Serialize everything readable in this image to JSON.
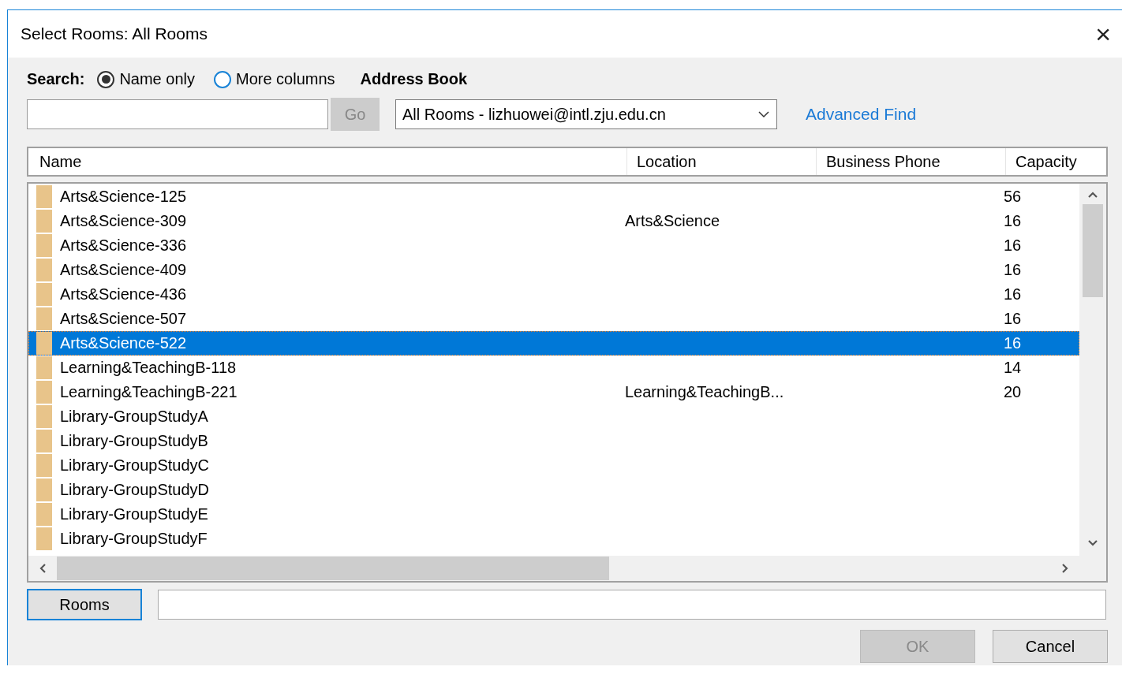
{
  "window": {
    "title": "Select Rooms: All Rooms",
    "close": "×"
  },
  "search": {
    "label": "Search:",
    "options": [
      {
        "label": "Name only",
        "selected": true
      },
      {
        "label": "More columns",
        "selected": false
      }
    ],
    "go_button": {
      "label": "Go",
      "disabled": true
    }
  },
  "address_book": {
    "label": "Address Book",
    "value": "All Rooms - lizhuowei@intl.zju.edu.cn"
  },
  "advanced_find": "Advanced Find",
  "table": {
    "columns": [
      "Name",
      "Location",
      "Business Phone",
      "Capacity"
    ],
    "rows": [
      {
        "name": "Arts&Science-125",
        "location": "",
        "phone": "",
        "capacity": "56",
        "selected": false
      },
      {
        "name": "Arts&Science-309",
        "location": "Arts&Science",
        "phone": "",
        "capacity": "16",
        "selected": false
      },
      {
        "name": "Arts&Science-336",
        "location": "",
        "phone": "",
        "capacity": "16",
        "selected": false
      },
      {
        "name": "Arts&Science-409",
        "location": "",
        "phone": "",
        "capacity": "16",
        "selected": false
      },
      {
        "name": "Arts&Science-436",
        "location": "",
        "phone": "",
        "capacity": "16",
        "selected": false
      },
      {
        "name": "Arts&Science-507",
        "location": "",
        "phone": "",
        "capacity": "16",
        "selected": false
      },
      {
        "name": "Arts&Science-522",
        "location": "",
        "phone": "",
        "capacity": "16",
        "selected": true
      },
      {
        "name": "Learning&TeachingB-118",
        "location": "",
        "phone": "",
        "capacity": "14",
        "selected": false
      },
      {
        "name": "Learning&TeachingB-221",
        "location": "Learning&TeachingB...",
        "phone": "",
        "capacity": "20",
        "selected": false
      },
      {
        "name": "Library-GroupStudyA",
        "location": "",
        "phone": "",
        "capacity": "",
        "selected": false
      },
      {
        "name": "Library-GroupStudyB",
        "location": "",
        "phone": "",
        "capacity": "",
        "selected": false
      },
      {
        "name": "Library-GroupStudyC",
        "location": "",
        "phone": "",
        "capacity": "",
        "selected": false
      },
      {
        "name": "Library-GroupStudyD",
        "location": "",
        "phone": "",
        "capacity": "",
        "selected": false
      },
      {
        "name": "Library-GroupStudyE",
        "location": "",
        "phone": "",
        "capacity": "",
        "selected": false
      },
      {
        "name": "Library-GroupStudyF",
        "location": "",
        "phone": "",
        "capacity": "",
        "selected": false
      }
    ]
  },
  "rooms_button": "Rooms",
  "buttons": [
    {
      "label": "OK",
      "disabled": true
    },
    {
      "label": "Cancel",
      "disabled": false
    }
  ]
}
